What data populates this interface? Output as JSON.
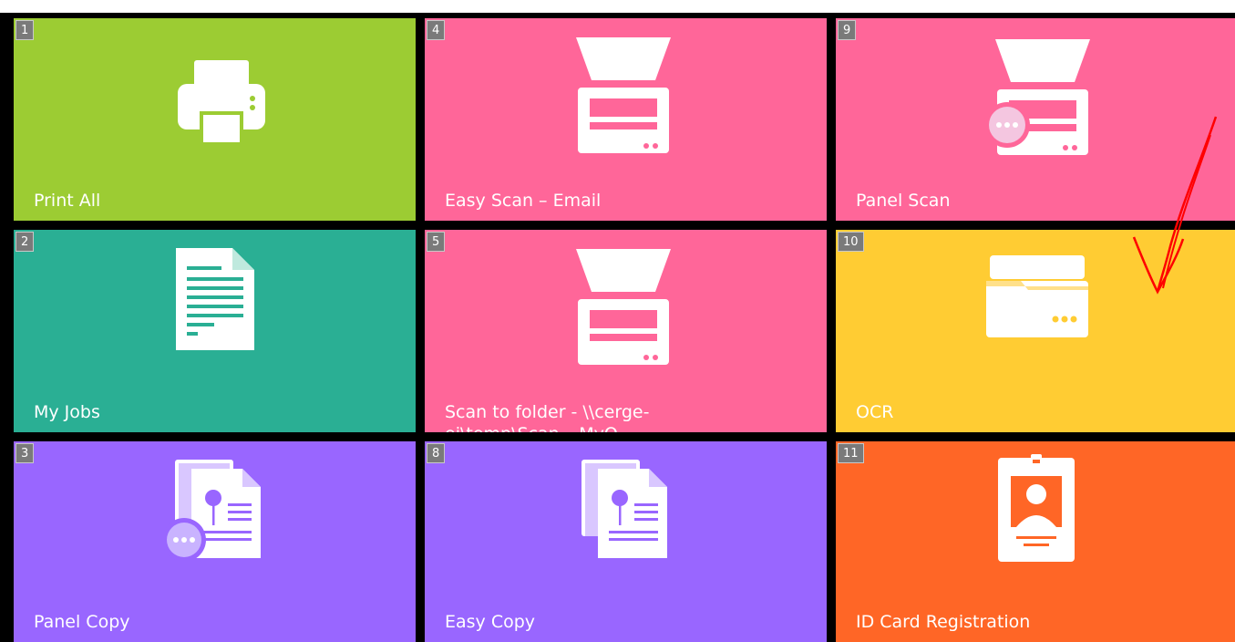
{
  "colors": {
    "green": "#9ccc33",
    "teal": "#2aaf94",
    "pink": "#ff6699",
    "yellow": "#ffcc33",
    "purple": "#9966ff",
    "orange": "#ff6626",
    "annotation": "#ff0000"
  },
  "tiles": [
    {
      "number": "1",
      "label": "Print All",
      "icon": "printer-icon"
    },
    {
      "number": "4",
      "label": "Easy Scan – Email",
      "icon": "scanner-icon"
    },
    {
      "number": "9",
      "label": "Panel Scan",
      "icon": "scanner-more-icon"
    },
    {
      "number": "2",
      "label": "My Jobs",
      "icon": "document-icon"
    },
    {
      "number": "5",
      "label": "Scan to folder - \\\\cerge-ei\\temp\\Scan – MyQ",
      "icon": "scanner-icon"
    },
    {
      "number": "10",
      "label": "OCR",
      "icon": "folder-icon"
    },
    {
      "number": "3",
      "label": "Panel Copy",
      "icon": "copy-more-icon"
    },
    {
      "number": "8",
      "label": "Easy Copy",
      "icon": "copy-icon"
    },
    {
      "number": "11",
      "label": "ID Card Registration",
      "icon": "id-card-icon"
    }
  ]
}
